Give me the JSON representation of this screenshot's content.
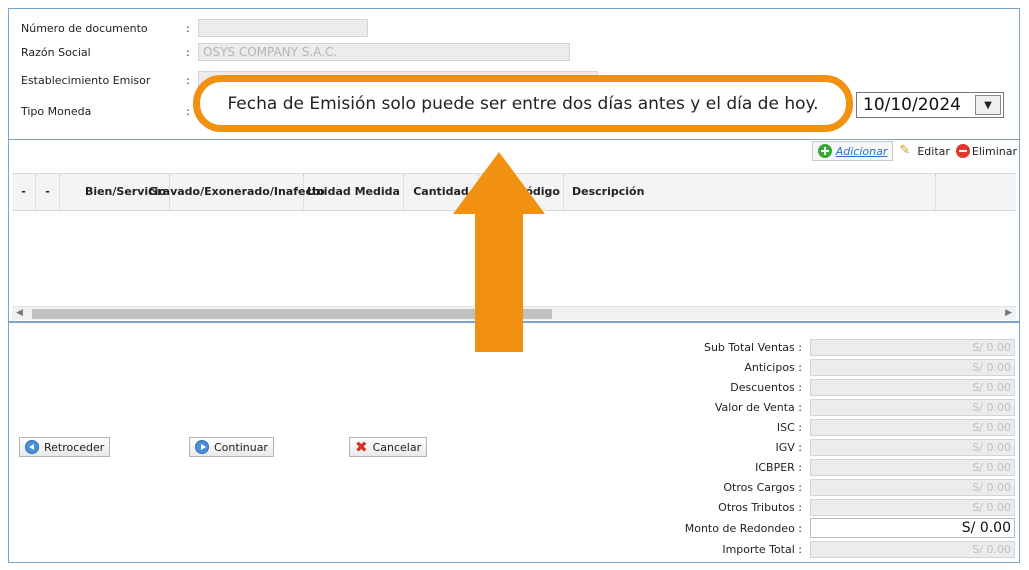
{
  "header_form": {
    "doc_number": {
      "label": "Número de documento",
      "colon": ":",
      "value": ""
    },
    "razon_social": {
      "label": "Razón Social",
      "colon": ":",
      "value": "OSYS COMPANY S.A.C."
    },
    "establecimiento": {
      "label": "Establecimiento Emisor",
      "colon": ":",
      "value": ""
    },
    "tipo_moneda": {
      "label": "Tipo Moneda",
      "colon": ":",
      "value": ""
    }
  },
  "fecha_emision": {
    "value": "10/10/2024",
    "dropdown_glyph": "▼"
  },
  "callout": {
    "message": "Fecha de Emisión solo puede ser entre dos días antes y el día de hoy.",
    "color": "#f29111"
  },
  "toolbar": {
    "add_label": "Adicionar",
    "edit_label": "Editar",
    "delete_label": "Eliminar"
  },
  "grid": {
    "columns": [
      "-",
      "-",
      "Bien/Servicio",
      "Gravado/Exonerado/Inafecto",
      "Unidad Medida",
      "Cantidad",
      "Código",
      "Descripción",
      ""
    ]
  },
  "buttons": {
    "back": "Retroceder",
    "next": "Continuar",
    "cancel": "Cancelar"
  },
  "totals": [
    {
      "label": "Sub Total Ventas :",
      "value": "S/ 0.00"
    },
    {
      "label": "Anticipos :",
      "value": "S/ 0.00"
    },
    {
      "label": "Descuentos :",
      "value": "S/ 0.00"
    },
    {
      "label": "Valor de Venta :",
      "value": "S/ 0.00"
    },
    {
      "label": "ISC :",
      "value": "S/ 0.00"
    },
    {
      "label": "IGV :",
      "value": "S/ 0.00"
    },
    {
      "label": "ICBPER :",
      "value": "S/ 0.00"
    },
    {
      "label": "Otros Cargos :",
      "value": "S/ 0.00"
    },
    {
      "label": "Otros Tributos :",
      "value": "S/ 0.00"
    },
    {
      "label": "Monto de Redondeo :",
      "value": "S/ 0.00"
    },
    {
      "label": "Importe Total :",
      "value": "S/ 0.00"
    }
  ],
  "colors": {
    "accent": "#f29111",
    "border": "#7aa4c9",
    "link": "#2a6fc9"
  }
}
